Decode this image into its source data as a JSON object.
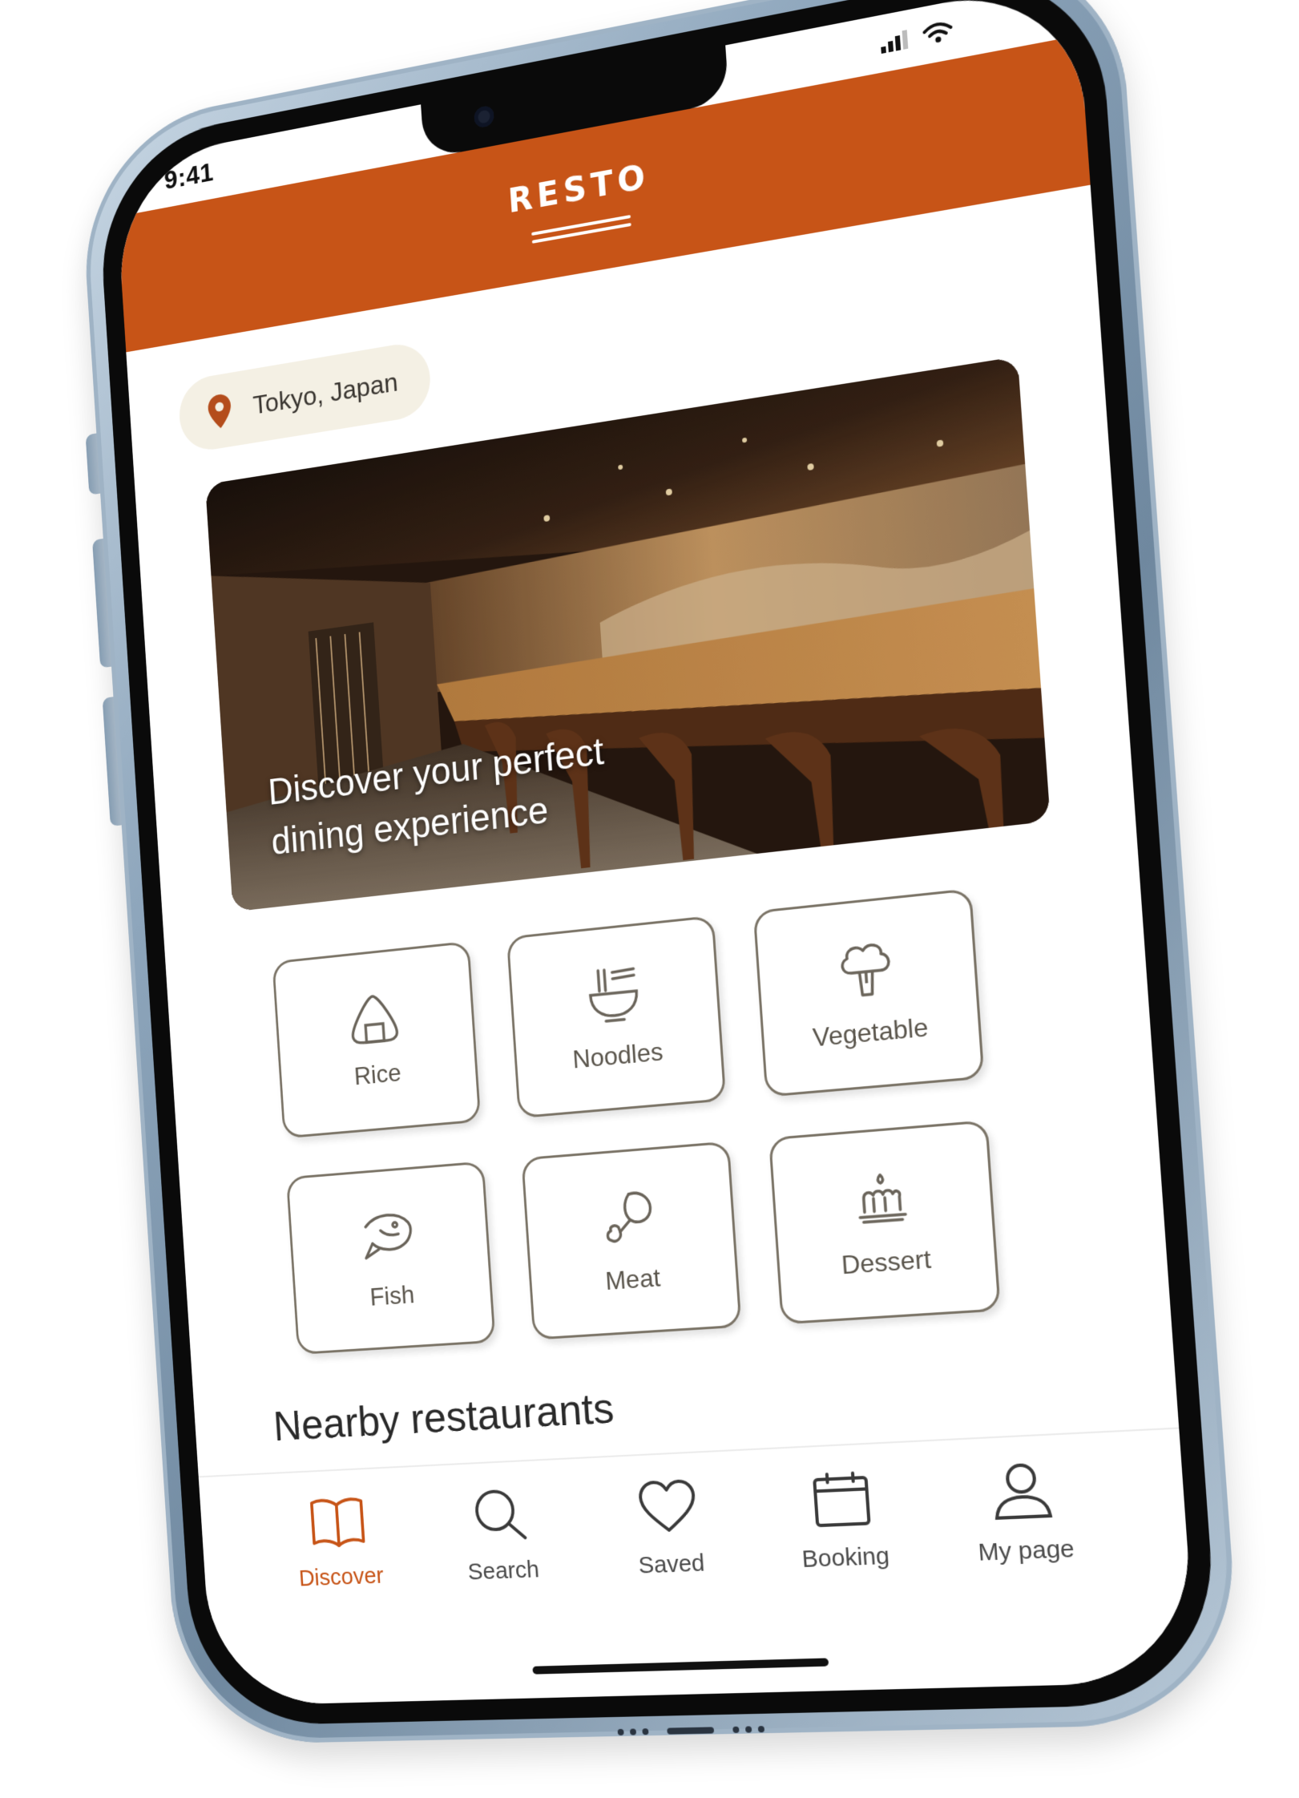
{
  "status": {
    "time": "9:41"
  },
  "app": {
    "title": "RESTO"
  },
  "location": {
    "label": "Tokyo, Japan"
  },
  "hero": {
    "headline_line1": "Discover your perfect",
    "headline_line2": "dining experience"
  },
  "categories": [
    {
      "label": "Rice",
      "icon": "rice-ball-icon"
    },
    {
      "label": "Noodles",
      "icon": "noodle-bowl-icon"
    },
    {
      "label": "Vegetable",
      "icon": "broccoli-icon"
    },
    {
      "label": "Fish",
      "icon": "fish-icon"
    },
    {
      "label": "Meat",
      "icon": "drumstick-icon"
    },
    {
      "label": "Dessert",
      "icon": "cake-icon"
    }
  ],
  "nearby": {
    "title": "Nearby restaurants"
  },
  "tabs": [
    {
      "label": "Discover",
      "icon": "open-book-icon",
      "active": true
    },
    {
      "label": "Search",
      "icon": "search-icon",
      "active": false
    },
    {
      "label": "Saved",
      "icon": "heart-icon",
      "active": false
    },
    {
      "label": "Booking",
      "icon": "calendar-icon",
      "active": false
    },
    {
      "label": "My page",
      "icon": "user-icon",
      "active": false
    }
  ],
  "colors": {
    "brand": "#c75417",
    "pill_bg": "#f4f0e4",
    "card_border": "#7b7467",
    "frame": "#8ea6bc"
  }
}
